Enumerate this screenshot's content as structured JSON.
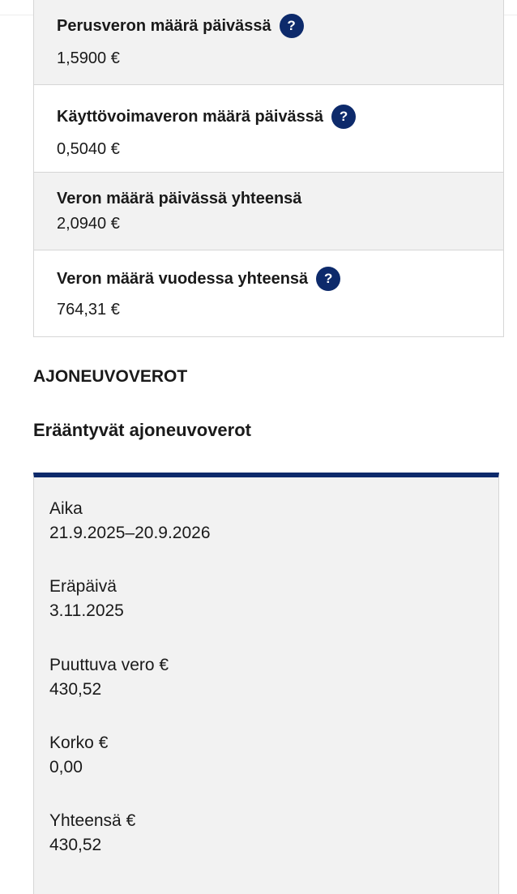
{
  "tax_rows": [
    {
      "label": "Perusveron määrä päivässä",
      "value": "1,5900 €",
      "help": "?"
    },
    {
      "label": "Käyttövoimaveron määrä päivässä",
      "value": "0,5040 €",
      "help": "?"
    },
    {
      "label": "Veron määrä päivässä yhteensä",
      "value": "2,0940 €"
    },
    {
      "label": "Veron määrä vuodessa yhteensä",
      "value": "764,31 €",
      "help": "?"
    }
  ],
  "section_title": "AJONEUVOVEROT",
  "subsection_title": "Erääntyvät ajoneuvoverot",
  "due": {
    "period_label": "Aika",
    "period_value": "21.9.2025–20.9.2026",
    "due_date_label": "Eräpäivä",
    "due_date_value": "3.11.2025",
    "missing_tax_label": "Puuttuva vero €",
    "missing_tax_value": "430,52",
    "interest_label": "Korko €",
    "interest_value": "0,00",
    "total_label": "Yhteensä €",
    "total_value": "430,52"
  },
  "colors": {
    "accent": "#0d2a6b",
    "shaded_row": "#f2f2f2",
    "border": "#d6d6d6"
  },
  "icons": {
    "help": "question-circle-icon"
  }
}
